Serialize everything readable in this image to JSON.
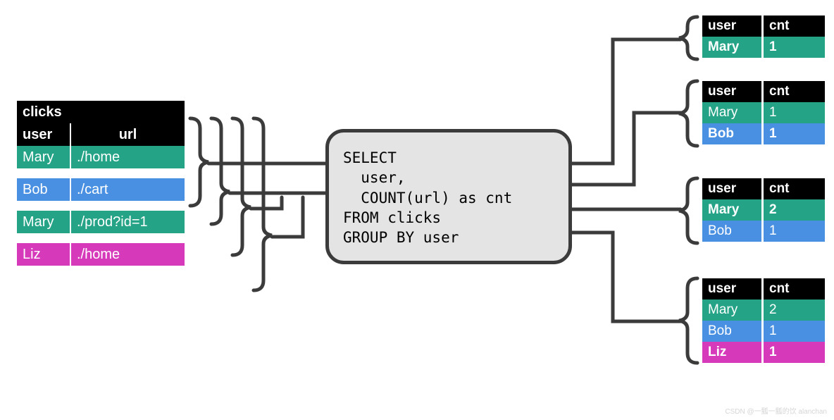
{
  "input_table": {
    "title": "clicks",
    "columns": [
      "user",
      "url"
    ],
    "rows": [
      {
        "color": "teal",
        "cells": [
          "Mary",
          "./home"
        ]
      },
      {
        "color": "blue",
        "cells": [
          "Bob",
          "./cart"
        ]
      },
      {
        "color": "teal",
        "cells": [
          "Mary",
          "./prod?id=1"
        ]
      },
      {
        "color": "pink",
        "cells": [
          "Liz",
          "./home"
        ]
      }
    ]
  },
  "sql": "SELECT\n  user,\n  COUNT(url) as cnt\nFROM clicks\nGROUP BY user",
  "outputs": [
    {
      "columns": [
        "user",
        "cnt"
      ],
      "rows": [
        {
          "color": "teal",
          "bold": true,
          "cells": [
            "Mary",
            "1"
          ]
        }
      ]
    },
    {
      "columns": [
        "user",
        "cnt"
      ],
      "rows": [
        {
          "color": "teal",
          "bold": false,
          "cells": [
            "Mary",
            "1"
          ]
        },
        {
          "color": "blue",
          "bold": true,
          "cells": [
            "Bob",
            "1"
          ]
        }
      ]
    },
    {
      "columns": [
        "user",
        "cnt"
      ],
      "rows": [
        {
          "color": "teal",
          "bold": true,
          "cells": [
            "Mary",
            "2"
          ]
        },
        {
          "color": "blue",
          "bold": false,
          "cells": [
            "Bob",
            "1"
          ]
        }
      ]
    },
    {
      "columns": [
        "user",
        "cnt"
      ],
      "rows": [
        {
          "color": "teal",
          "bold": false,
          "cells": [
            "Mary",
            "2"
          ]
        },
        {
          "color": "blue",
          "bold": false,
          "cells": [
            "Bob",
            "1"
          ]
        },
        {
          "color": "pink",
          "bold": true,
          "cells": [
            "Liz",
            "1"
          ]
        }
      ]
    }
  ],
  "colors": {
    "teal": "#24a386",
    "blue": "#4a90e2",
    "pink": "#d63aba"
  },
  "watermark": "CSDN @一瓢一瓢的饮 alanchan"
}
